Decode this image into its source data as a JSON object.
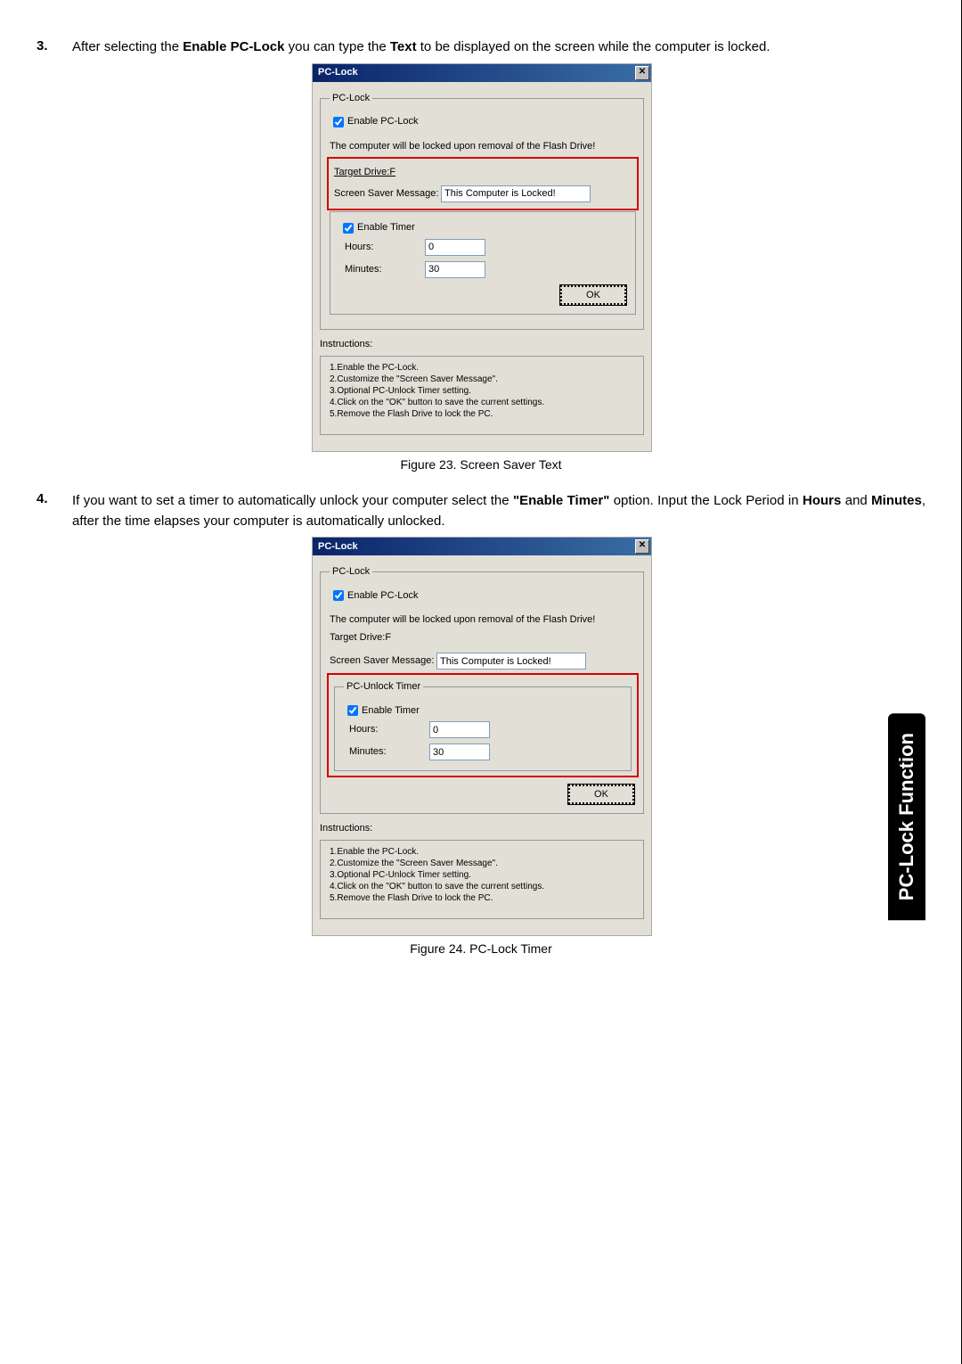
{
  "side_tab": "PC-Lock Function",
  "steps": {
    "s3": {
      "num": "3.",
      "text_before": "After selecting the ",
      "bold1": "Enable PC-Lock",
      "text_mid1": " you can type the ",
      "bold2": "Text",
      "text_after": " to be displayed on the screen while the computer is locked."
    },
    "s4": {
      "num": "4.",
      "text_before": "If you want to set a timer to automatically unlock your computer select the ",
      "bold1": "\"Enable Timer\"",
      "text_mid1": " option. Input the Lock Period in ",
      "bold2": "Hours",
      "text_mid2": " and ",
      "bold3": "Minutes",
      "text_after": ", after the time elapses your computer is automatically unlocked."
    }
  },
  "captions": {
    "fig23": "Figure 23. Screen Saver Text",
    "fig24": "Figure 24. PC-Lock Timer"
  },
  "dialog": {
    "title": "PC-Lock",
    "close": "✕",
    "group_label": "PC-Lock",
    "enable_pclock": "Enable PC-Lock",
    "locked_msg": "The computer will be locked upon removal of the Flash Drive!",
    "target_drive": "Target Drive:F",
    "screen_saver_label": "Screen Saver Message:",
    "screen_saver_value": "This Computer is Locked!",
    "timer_group": "PC-Unlock Timer",
    "enable_timer": "Enable Timer",
    "hours_label": "Hours:",
    "hours_value": "0",
    "minutes_label": "Minutes:",
    "minutes_value": "30",
    "ok": "OK",
    "instructions_label": "Instructions:",
    "instructions": [
      "1.Enable the PC-Lock.",
      "2.Customize the \"Screen Saver Message\".",
      "3.Optional PC-Unlock Timer setting.",
      "4.Click on the \"OK\" button to save the current settings.",
      "5.Remove the Flash Drive to lock the PC."
    ]
  }
}
